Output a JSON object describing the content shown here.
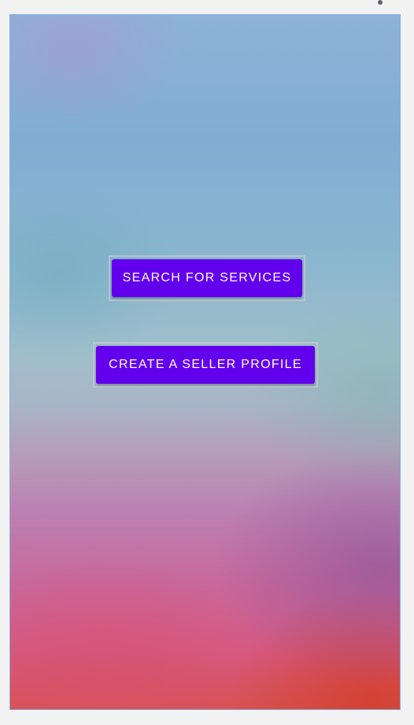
{
  "actions": {
    "search_label": "SEARCH FOR SERVICES",
    "seller_label": "CREATE A SELLER PROFILE"
  },
  "colors": {
    "button_bg": "#6200ee",
    "button_text": "#ffffff",
    "screen_border": "#7fb0e6"
  },
  "icons": {
    "overflow": "overflow-menu-icon"
  }
}
